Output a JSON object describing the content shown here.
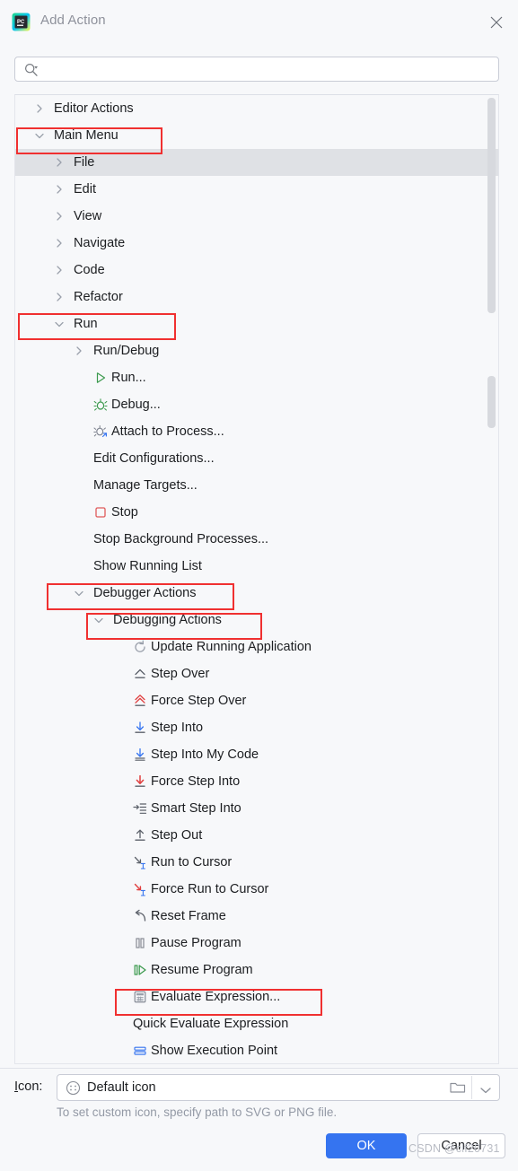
{
  "window": {
    "title": "Add Action",
    "logo_icon": "pycharm-logo-icon",
    "close_icon": "close-icon"
  },
  "search": {
    "value": "",
    "placeholder": "",
    "icon": "search-icon"
  },
  "tree": {
    "items": [
      {
        "label": "Editor Actions",
        "depth": 0,
        "arrow": "right",
        "icon": null,
        "selected": false,
        "highlight": false
      },
      {
        "label": "Main Menu",
        "depth": 0,
        "arrow": "down",
        "icon": null,
        "selected": false,
        "highlight": true
      },
      {
        "label": "File",
        "depth": 1,
        "arrow": "right",
        "icon": null,
        "selected": true,
        "highlight": false
      },
      {
        "label": "Edit",
        "depth": 1,
        "arrow": "right",
        "icon": null,
        "selected": false,
        "highlight": false
      },
      {
        "label": "View",
        "depth": 1,
        "arrow": "right",
        "icon": null,
        "selected": false,
        "highlight": false
      },
      {
        "label": "Navigate",
        "depth": 1,
        "arrow": "right",
        "icon": null,
        "selected": false,
        "highlight": false
      },
      {
        "label": "Code",
        "depth": 1,
        "arrow": "right",
        "icon": null,
        "selected": false,
        "highlight": false
      },
      {
        "label": "Refactor",
        "depth": 1,
        "arrow": "right",
        "icon": null,
        "selected": false,
        "highlight": false
      },
      {
        "label": "Run",
        "depth": 1,
        "arrow": "down",
        "icon": null,
        "selected": false,
        "highlight": true
      },
      {
        "label": "Run/Debug",
        "depth": 2,
        "arrow": "right",
        "icon": null,
        "selected": false,
        "highlight": false
      },
      {
        "label": "Run...",
        "depth": 2,
        "arrow": "none",
        "icon": "run-play-icon",
        "selected": false,
        "highlight": false
      },
      {
        "label": "Debug...",
        "depth": 2,
        "arrow": "none",
        "icon": "debug-bug-icon",
        "selected": false,
        "highlight": false
      },
      {
        "label": "Attach to Process...",
        "depth": 2,
        "arrow": "none",
        "icon": "attach-process-icon",
        "selected": false,
        "highlight": false
      },
      {
        "label": "Edit Configurations...",
        "depth": 2,
        "arrow": "none",
        "icon": null,
        "selected": false,
        "highlight": false
      },
      {
        "label": "Manage Targets...",
        "depth": 2,
        "arrow": "none",
        "icon": null,
        "selected": false,
        "highlight": false
      },
      {
        "label": "Stop",
        "depth": 2,
        "arrow": "none",
        "icon": "stop-square-icon",
        "selected": false,
        "highlight": false
      },
      {
        "label": "Stop Background Processes...",
        "depth": 2,
        "arrow": "none",
        "icon": null,
        "selected": false,
        "highlight": false
      },
      {
        "label": "Show Running List",
        "depth": 2,
        "arrow": "none",
        "icon": null,
        "selected": false,
        "highlight": false
      },
      {
        "label": "Debugger Actions",
        "depth": 2,
        "arrow": "down",
        "icon": null,
        "selected": false,
        "highlight": true
      },
      {
        "label": "Debugging Actions",
        "depth": 3,
        "arrow": "down",
        "icon": null,
        "selected": false,
        "highlight": true
      },
      {
        "label": "Update Running Application",
        "depth": 4,
        "arrow": "none",
        "icon": "update-refresh-icon",
        "selected": false,
        "highlight": false
      },
      {
        "label": "Step Over",
        "depth": 4,
        "arrow": "none",
        "icon": "step-over-icon",
        "selected": false,
        "highlight": false
      },
      {
        "label": "Force Step Over",
        "depth": 4,
        "arrow": "none",
        "icon": "force-step-over-icon",
        "selected": false,
        "highlight": false
      },
      {
        "label": "Step Into",
        "depth": 4,
        "arrow": "none",
        "icon": "step-into-icon",
        "selected": false,
        "highlight": false
      },
      {
        "label": "Step Into My Code",
        "depth": 4,
        "arrow": "none",
        "icon": "step-into-my-code-icon",
        "selected": false,
        "highlight": false
      },
      {
        "label": "Force Step Into",
        "depth": 4,
        "arrow": "none",
        "icon": "force-step-into-icon",
        "selected": false,
        "highlight": false
      },
      {
        "label": "Smart Step Into",
        "depth": 4,
        "arrow": "none",
        "icon": "smart-step-into-icon",
        "selected": false,
        "highlight": false
      },
      {
        "label": "Step Out",
        "depth": 4,
        "arrow": "none",
        "icon": "step-out-icon",
        "selected": false,
        "highlight": false
      },
      {
        "label": "Run to Cursor",
        "depth": 4,
        "arrow": "none",
        "icon": "run-to-cursor-icon",
        "selected": false,
        "highlight": false
      },
      {
        "label": "Force Run to Cursor",
        "depth": 4,
        "arrow": "none",
        "icon": "force-run-to-cursor-icon",
        "selected": false,
        "highlight": false
      },
      {
        "label": "Reset Frame",
        "depth": 4,
        "arrow": "none",
        "icon": "reset-frame-icon",
        "selected": false,
        "highlight": false
      },
      {
        "label": "Pause Program",
        "depth": 4,
        "arrow": "none",
        "icon": "pause-icon",
        "selected": false,
        "highlight": false
      },
      {
        "label": "Resume Program",
        "depth": 4,
        "arrow": "none",
        "icon": "resume-icon",
        "selected": false,
        "highlight": false
      },
      {
        "label": "Evaluate Expression...",
        "depth": 4,
        "arrow": "none",
        "icon": "evaluate-expression-icon",
        "selected": false,
        "highlight": true
      },
      {
        "label": "Quick Evaluate Expression",
        "depth": 4,
        "arrow": "none",
        "icon": null,
        "selected": false,
        "highlight": false
      },
      {
        "label": "Show Execution Point",
        "depth": 4,
        "arrow": "none",
        "icon": "show-execution-point-icon",
        "selected": false,
        "highlight": false
      }
    ]
  },
  "icon_row": {
    "label": "Icon:",
    "value": "Default icon",
    "default_icon": "default-icon-glyph",
    "browse_icon": "folder-icon",
    "dropdown_icon": "chevron-down-icon",
    "hint": "To set custom icon, specify path to SVG or PNG file."
  },
  "buttons": {
    "ok": "OK",
    "cancel": "Cancel"
  },
  "watermark": "CSDN @clf20731",
  "colors": {
    "accent": "#3574f0",
    "annotation": "#f03030",
    "selection": "#dfe1e5",
    "background": "#f7f8fa"
  }
}
